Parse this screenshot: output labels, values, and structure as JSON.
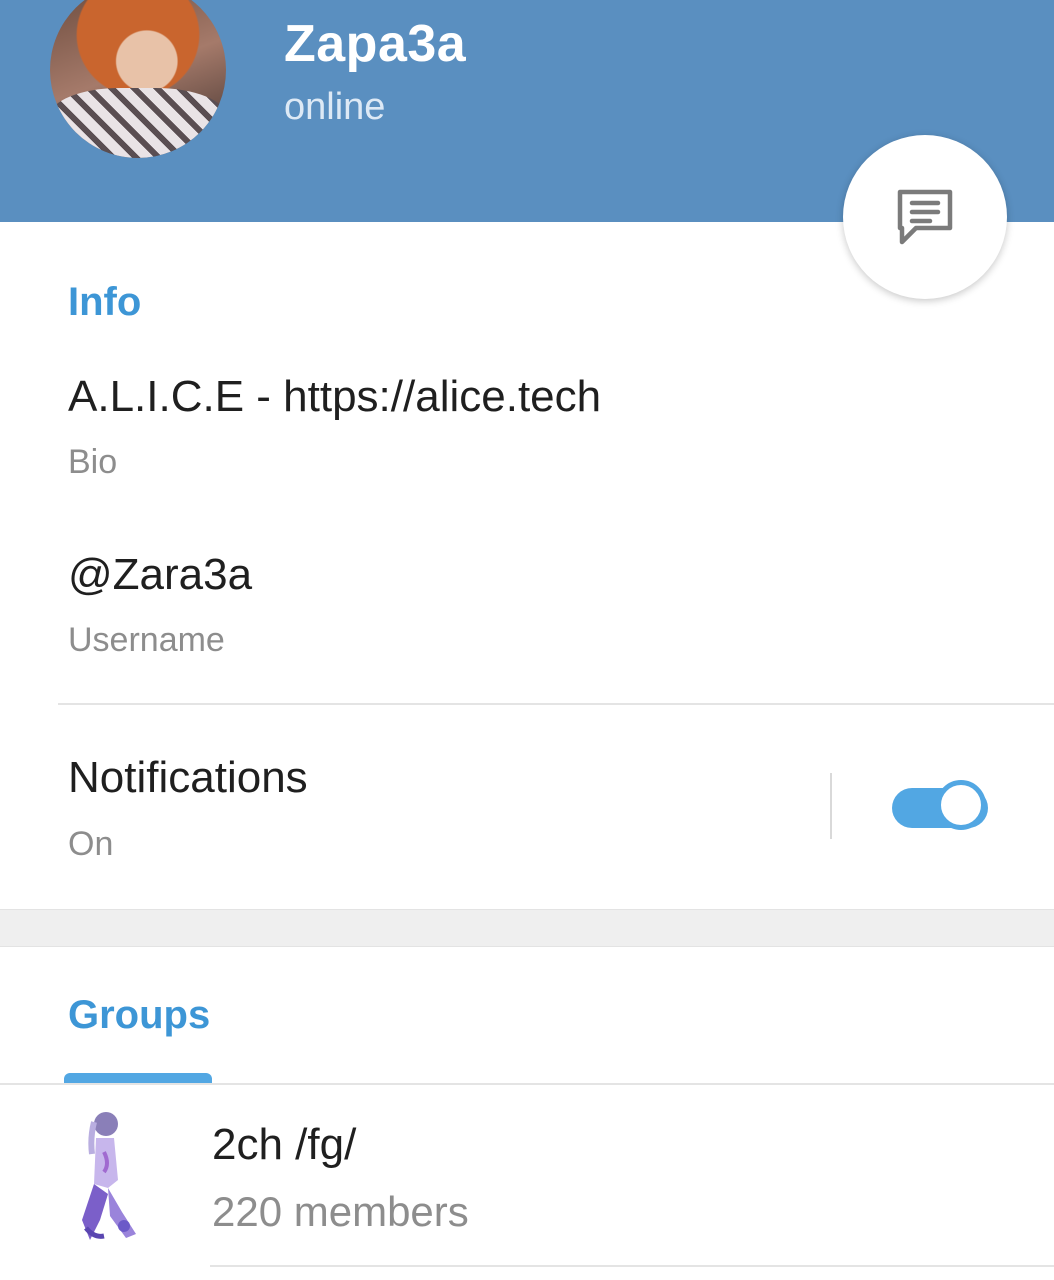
{
  "header": {
    "name": "Zapa3a",
    "status": "online"
  },
  "info": {
    "section_title": "Info",
    "bio_value": "A.L.I.C.E - https://alice.tech",
    "bio_label": "Bio",
    "username_value": "@Zara3a",
    "username_label": "Username",
    "notifications_title": "Notifications",
    "notifications_state": "On",
    "notifications_enabled": true
  },
  "groups": {
    "section_title": "Groups",
    "items": [
      {
        "name": "2ch /fg/",
        "members": "220 members"
      }
    ]
  },
  "icons": {
    "message": "message-icon",
    "avatar": "profile-avatar",
    "group_avatar": "group-avatar"
  },
  "colors": {
    "header_bg": "#5a8fc0",
    "accent": "#3d96d6",
    "toggle": "#52a7e3"
  }
}
